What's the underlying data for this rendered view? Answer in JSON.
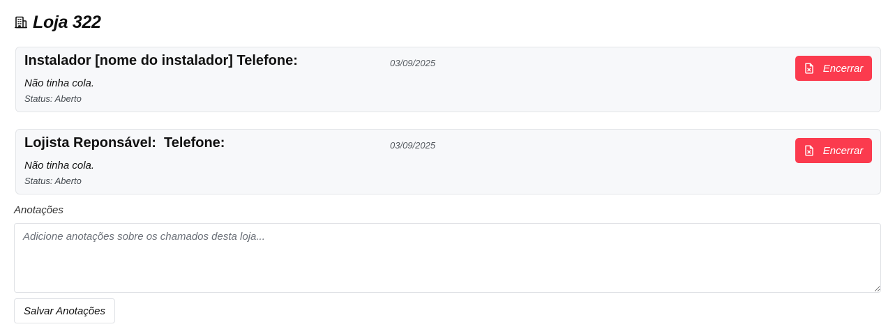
{
  "header": {
    "title": "Loja 322",
    "icon": "building-icon"
  },
  "tickets": [
    {
      "title": "Instalador [nome do instalador] Telefone:",
      "date": "03/09/2025",
      "description": "Não tinha cola.",
      "status": "Status: Aberto",
      "close_label": "Encerrar",
      "close_icon": "file-x-icon"
    },
    {
      "title": "Lojista Reponsável:  Telefone:",
      "date": "03/09/2025",
      "description": "Não tinha cola.",
      "status": "Status: Aberto",
      "close_label": "Encerrar",
      "close_icon": "file-x-icon"
    }
  ],
  "notes": {
    "label": "Anotações",
    "placeholder": "Adicione anotações sobre os chamados desta loja...",
    "value": "",
    "save_label": "Salvar Anotações"
  },
  "colors": {
    "danger": "#fb3b4e",
    "card_bg": "#f7f8fa",
    "border": "#e3e5e8"
  }
}
